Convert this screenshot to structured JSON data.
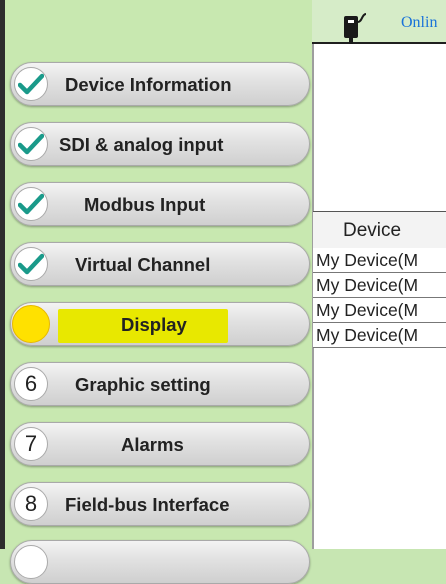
{
  "header": {
    "status_text": "Onlin"
  },
  "wizard": {
    "steps": [
      {
        "marker": "check",
        "label": "Device Information",
        "state": "done"
      },
      {
        "marker": "check",
        "label": "SDI & analog input",
        "state": "done"
      },
      {
        "marker": "check",
        "label": "Modbus Input",
        "state": "done"
      },
      {
        "marker": "check",
        "label": "Virtual Channel",
        "state": "done"
      },
      {
        "marker": "dot",
        "label": "Display",
        "state": "active"
      },
      {
        "marker": "6",
        "label": "Graphic setting",
        "state": "pending"
      },
      {
        "marker": "7",
        "label": "Alarms",
        "state": "pending"
      },
      {
        "marker": "8",
        "label": "Field-bus Interface",
        "state": "pending"
      }
    ]
  },
  "device_table": {
    "column_header": "Device",
    "rows": [
      "My Device(M",
      "My Device(M",
      "My Device(M",
      "My Device(M"
    ]
  },
  "colors": {
    "panel_bg": "#c8e8b0",
    "check": "#1a9a8a",
    "active_dot": "#ffe100",
    "highlight": "#e8e800",
    "status_text": "#1a73d9"
  }
}
